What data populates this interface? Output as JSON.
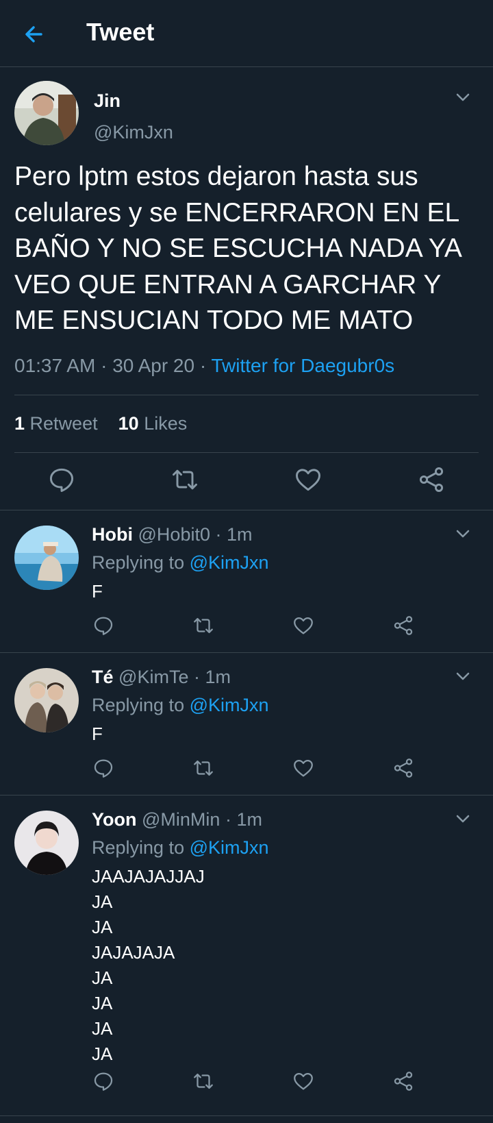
{
  "header": {
    "title": "Tweet"
  },
  "tweet": {
    "author_name": "Jin",
    "author_handle": "@KimJxn",
    "text": "Pero lptm estos dejaron hasta sus celulares y se ENCERRARON EN EL BAÑO Y NO SE ESCUCHA NADA YA VEO QUE ENTRAN A GARCHAR Y ME ENSUCIAN TODO ME MATO",
    "time": "01:37 AM",
    "separator": "·",
    "date": "30 Apr 20",
    "source": "Twitter for Daegubr0s",
    "retweet_count": "1",
    "retweet_label": "Retweet",
    "like_count": "10",
    "like_label": "Likes"
  },
  "replies": [
    {
      "name": "Hobi",
      "handle": "@Hobit0",
      "time": "1m",
      "replying_label": "Replying to",
      "replying_to": "@KimJxn",
      "lines": [
        "F"
      ]
    },
    {
      "name": "Té",
      "handle": "@KimTe",
      "time": "1m",
      "replying_label": "Replying to",
      "replying_to": "@KimJxn",
      "lines": [
        "F"
      ]
    },
    {
      "name": "Yoon",
      "handle": "@MinMin",
      "time": "1m",
      "replying_label": "Replying to",
      "replying_to": "@KimJxn",
      "lines": [
        "JAAJAJAJJAJ",
        "JA",
        "JA",
        "JAJAJAJA",
        "JA",
        "JA",
        "JA",
        "JA"
      ]
    }
  ],
  "colors": {
    "background": "#15202b",
    "accent": "#1da1f2",
    "muted_text": "#8899a6",
    "divider": "#38444d"
  },
  "icons": {
    "back": "arrow-left-icon",
    "caret": "chevron-down-icon",
    "reply": "reply-icon",
    "retweet": "retweet-icon",
    "like": "heart-icon",
    "share": "share-icon"
  }
}
